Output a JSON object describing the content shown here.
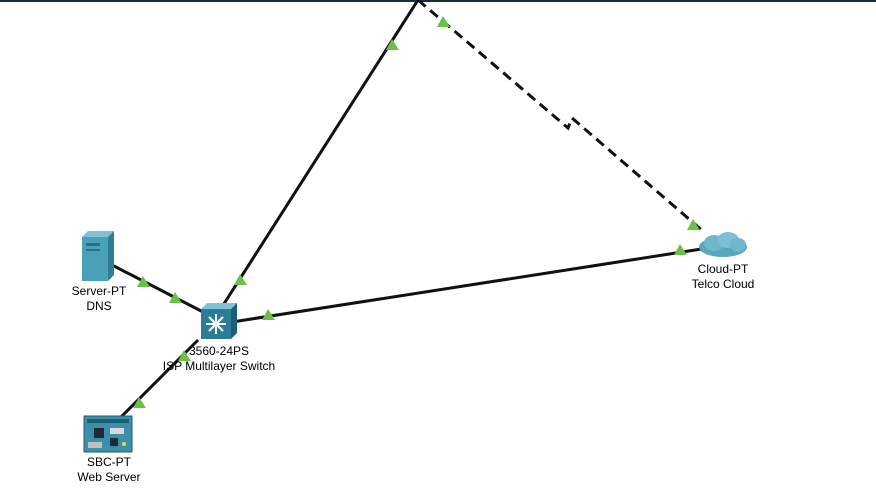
{
  "workspace": {
    "accent_link_up": "#6cc04a",
    "link_color": "#111111"
  },
  "devices": {
    "dns_server": {
      "model": "Server-PT",
      "name": "DNS",
      "icon": "server-icon"
    },
    "switch": {
      "model": "3560-24PS",
      "name": "ISP Multilayer Switch",
      "icon": "multilayer-switch-icon"
    },
    "web_server": {
      "model": "SBC-PT",
      "name": "Web Server",
      "icon": "sbc-board-icon"
    },
    "cloud": {
      "model": "Cloud-PT",
      "name": "Telco Cloud",
      "icon": "cloud-icon"
    }
  },
  "links": [
    {
      "from": "dns_server",
      "to": "switch",
      "type": "copper-straight",
      "status": "up"
    },
    {
      "from": "web_server",
      "to": "switch",
      "type": "copper-straight",
      "status": "up"
    },
    {
      "from": "switch",
      "to": "cloud",
      "type": "copper-straight",
      "status": "up"
    },
    {
      "from": "switch",
      "to": "offscreen-device",
      "type": "copper-straight",
      "status": "up"
    },
    {
      "from": "offscreen-device",
      "to": "cloud",
      "type": "serial-dce",
      "status": "up"
    }
  ]
}
